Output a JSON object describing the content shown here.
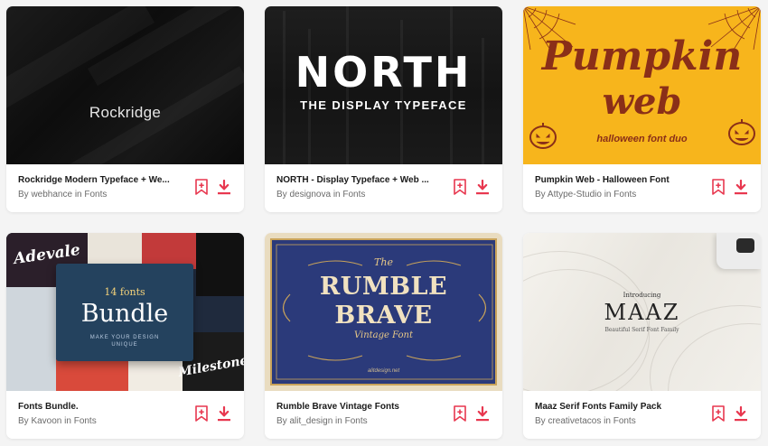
{
  "accent_color": "#e8374f",
  "items": [
    {
      "title": "Rockridge Modern Typeface + We...",
      "byline": "By webhance in Fonts",
      "thumb_text": {
        "main": "Rockridge"
      },
      "bookmark_icon": "bookmark-plus-icon",
      "download_icon": "download-icon"
    },
    {
      "title": "NORTH - Display Typeface + Web ...",
      "byline": "By designova in Fonts",
      "thumb_text": {
        "main": "NORTH",
        "sub": "THE DISPLAY TYPEFACE"
      },
      "bookmark_icon": "bookmark-plus-icon",
      "download_icon": "download-icon"
    },
    {
      "title": "Pumpkin Web - Halloween Font",
      "byline": "By Attype-Studio in Fonts",
      "thumb_text": {
        "line1": "Pumpkin",
        "line2": "web",
        "line3": "halloween font duo"
      },
      "bookmark_icon": "bookmark-plus-icon",
      "download_icon": "download-icon"
    },
    {
      "title": "Fonts Bundle.",
      "byline": "By Kavoon in Fonts",
      "thumb_text": {
        "count": "14 fonts",
        "main": "Bundle",
        "tag1": "MAKE YOUR DESIGN",
        "tag2": "UNIQUE",
        "script1": "Adevale",
        "script2": "Milestone"
      },
      "bookmark_icon": "bookmark-plus-icon",
      "download_icon": "download-icon"
    },
    {
      "title": "Rumble Brave Vintage Fonts",
      "byline": "By alit_design in Fonts",
      "thumb_text": {
        "the": "The",
        "line1": "RUMBLE",
        "line2": "BRAVE",
        "sub": "Vintage Font",
        "site": "alitdesign.net"
      },
      "bookmark_icon": "bookmark-plus-icon",
      "download_icon": "download-icon"
    },
    {
      "title": "Maaz Serif Fonts Family Pack",
      "byline": "By creativetacos in Fonts",
      "thumb_text": {
        "intro": "Introducing",
        "main": "MAAZ",
        "desc": "Beautiful Serif Font Family"
      },
      "bookmark_icon": "bookmark-plus-icon",
      "download_icon": "download-icon"
    }
  ]
}
